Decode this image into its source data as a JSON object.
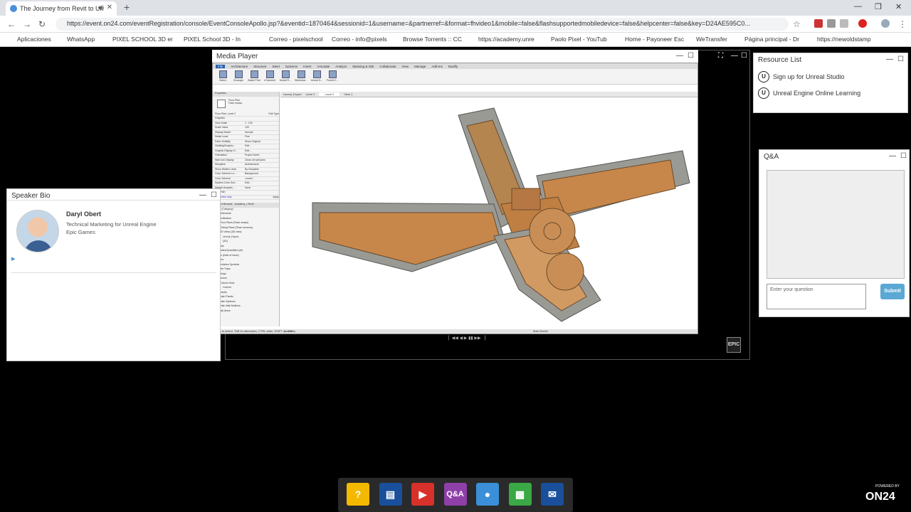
{
  "browser": {
    "tab_title": "The Journey from Revit to Un",
    "new_tab": "+",
    "url": "https://event.on24.com/eventRegistration/console/EventConsoleApollo.jsp?&eventid=1870464&sessionid=1&username=&partnerref=&format=fhvideo1&mobile=false&flashsupportedmobiledevice=false&helpcenter=false&key=D24AE595C0...",
    "bookmarks": [
      {
        "label": "Aplicaciones",
        "color": "#777"
      },
      {
        "label": "WhatsApp",
        "color": "#25d366"
      },
      {
        "label": "PIXEL SCHOOL 3D er",
        "color": "#1e88e5"
      },
      {
        "label": "PIXEL School 3D - In",
        "color": "#3b5998"
      },
      {
        "label": "Correo - pixelschool",
        "color": "#0a64c8"
      },
      {
        "label": "Correo - info@pixels",
        "color": "#0a64c8"
      },
      {
        "label": "Browse Torrents :: CC",
        "color": "#c00"
      },
      {
        "label": "https://academy.unre",
        "color": "#222"
      },
      {
        "label": "Paolo Pixel - YouTub",
        "color": "#e00"
      },
      {
        "label": "Home - Payoneer Esc",
        "color": "#f60"
      },
      {
        "label": "WeTransfer",
        "color": "#111"
      },
      {
        "label": "Página principal - Dr",
        "color": "#0061fe"
      },
      {
        "label": "https://newoldstamp",
        "color": "#2aa0e0"
      }
    ]
  },
  "media_player": {
    "title": "Media Player",
    "revit": {
      "menu": [
        "File",
        "Architecture",
        "Structure",
        "Steel",
        "Systems",
        "Insert",
        "Annotate",
        "Analyze",
        "Massing & Site",
        "Collaborate",
        "View",
        "Manage",
        "Add-Ins",
        "Modify"
      ],
      "tools": [
        "Select",
        "Enscape",
        "Batch Print",
        "eTransmit",
        "Model R...",
        "Workshar...",
        "Unreal D...",
        "FormIt C..."
      ],
      "view_tabs": [
        "Unreal_Export",
        "Level 1",
        "Level 2",
        "View 1"
      ],
      "active_tab": "Level 2",
      "properties_title": "Properties",
      "floor_plan_label": "Floor Plan",
      "floor_plan_sub": "Плат плана",
      "floor_plan_level": "Floor Plan: Level 2",
      "edit_type": "Edit Type",
      "properties_rows": [
        [
          "Graphics",
          ""
        ],
        [
          "View Scale",
          "1 : 100"
        ],
        [
          "Scale Value",
          "100"
        ],
        [
          "Display Model",
          "Normal"
        ],
        [
          "Detail Level",
          "Fine"
        ],
        [
          "Parts Visibility",
          "Show Original"
        ],
        [
          "Visibility/Graphic...",
          "Edit..."
        ],
        [
          "Graphic Display O...",
          "Edit..."
        ],
        [
          "Orientation",
          "Project North"
        ],
        [
          "Wall Join Display",
          "Clean all wall joins"
        ],
        [
          "Discipline",
          "Architectural"
        ],
        [
          "Show Hidden Lines",
          "By Discipline"
        ],
        [
          "Color Scheme Lo...",
          "Background"
        ],
        [
          "Color Scheme",
          "<none>"
        ],
        [
          "System Color Sch...",
          "Edit..."
        ],
        [
          "Default Analysis ...",
          "None"
        ],
        [
          "Sun Path",
          ""
        ]
      ],
      "properties_help": "Properties help",
      "apply": "Apply",
      "browser_title": "Project Browser - Academy_r-Revit",
      "browser_rows": [
        "Views (Category)",
        "Architectural",
        "Coordination",
        "Floor Plans (План этажа)",
        "Ceiling Plans (План потолка)",
        "3D Views (3D view)",
        "Unreal_Export",
        "{3D}",
        "Legends",
        "Schedules/Quantities (all)",
        "Sheets (Date of issue)",
        "Families",
        "Annotation Symbols",
        "Cable Trays",
        "Ceilings",
        "Columns",
        "Column brick",
        "Column",
        "Conduits",
        "Curtain Panels",
        "Curtain Systems",
        "Curtain Wall Mullions",
        "Detail Items"
      ],
      "status_text": "Click to select, TAB for alternates, CTRL adds, SHIFT unselects.",
      "scale_text": "1 : 100",
      "main_model": "Main Model"
    }
  },
  "speaker_bio": {
    "title": "Speaker Bio",
    "name": "Daryl Obert",
    "role": "Technical Marketing for Unreal Engine",
    "company": "Epic Games"
  },
  "resource_list": {
    "title": "Resource List",
    "items": [
      "Sign up for Unreal Studio",
      "Unreal Engine Online Learning"
    ]
  },
  "qa": {
    "title": "Q&A",
    "input_placeholder": "Enter your question",
    "submit": "Submit"
  },
  "dock": {
    "items": [
      {
        "name": "help",
        "label": "?",
        "color": "#f5b800"
      },
      {
        "name": "slides",
        "label": "▤",
        "color": "#1a4f9c"
      },
      {
        "name": "media",
        "label": "▶",
        "color": "#d8302a"
      },
      {
        "name": "qa",
        "label": "Q&A",
        "color": "#8e3fa8"
      },
      {
        "name": "speaker",
        "label": "●",
        "color": "#3a8fd8"
      },
      {
        "name": "resources",
        "label": "▦",
        "color": "#3aa845"
      },
      {
        "name": "chat",
        "label": "✉",
        "color": "#1a4f9c"
      }
    ]
  },
  "epic_logo_text": "EPIC",
  "on24": {
    "powered": "POWERED BY",
    "brand": "ON24"
  }
}
